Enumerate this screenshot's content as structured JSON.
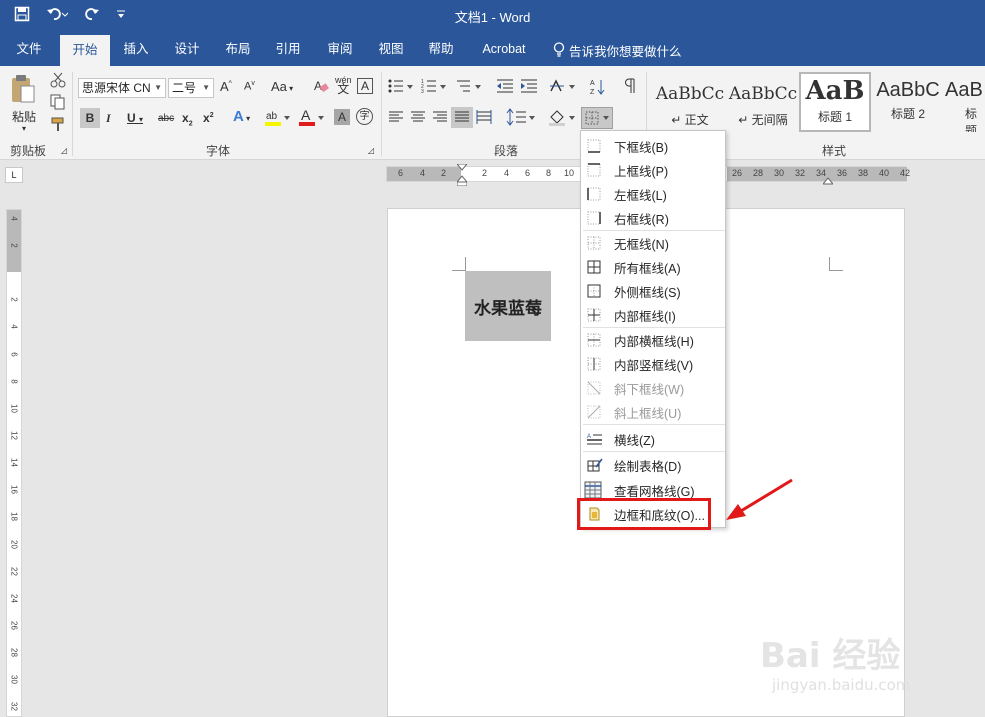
{
  "window": {
    "title": "文档1  -  Word"
  },
  "qat": {
    "save_icon": "save-icon",
    "undo_icon": "undo-icon",
    "redo_icon": "redo-icon",
    "customize_icon": "customize-icon"
  },
  "tabs": [
    {
      "label": "文件"
    },
    {
      "label": "开始"
    },
    {
      "label": "插入"
    },
    {
      "label": "设计"
    },
    {
      "label": "布局"
    },
    {
      "label": "引用"
    },
    {
      "label": "审阅"
    },
    {
      "label": "视图"
    },
    {
      "label": "帮助"
    },
    {
      "label": "Acrobat"
    }
  ],
  "tell_me": "告诉我你想要做什么",
  "ribbon": {
    "clipboard": {
      "paste_label": "粘贴",
      "group": "剪贴板"
    },
    "font": {
      "name": "思源宋体 CN",
      "size": "二号",
      "group": "字体",
      "aa": "Aa",
      "phonetic": "wén"
    },
    "paragraph": {
      "group": "段落"
    },
    "styles": {
      "group": "样式",
      "items": [
        {
          "sample": "AaBbCc",
          "name": "↵ 正文"
        },
        {
          "sample": "AaBbCc",
          "name": "↵ 无间隔"
        },
        {
          "sample": "AaB",
          "name": "标题 1"
        },
        {
          "sample": "AaBbC",
          "name": "标题 2"
        },
        {
          "sample": "AaB",
          "name": "标题"
        }
      ]
    }
  },
  "ruler": {
    "h_left": [
      "6",
      "4",
      "2"
    ],
    "h_mid": [
      "2",
      "4",
      "6",
      "8",
      "10"
    ],
    "h_right": [
      "26",
      "28",
      "30",
      "32",
      "34",
      "36",
      "38",
      "40",
      "42"
    ],
    "v": [
      "4",
      "2",
      "2",
      "4",
      "6",
      "8",
      "10",
      "12",
      "14",
      "16",
      "18",
      "20",
      "22",
      "24",
      "26",
      "28",
      "30",
      "32"
    ]
  },
  "document": {
    "cell_text": "水果蓝莓"
  },
  "border_menu": {
    "items": [
      {
        "label": "下框线(B)",
        "icon": "bottom-border-icon",
        "disabled": false
      },
      {
        "label": "上框线(P)",
        "icon": "top-border-icon",
        "disabled": false
      },
      {
        "label": "左框线(L)",
        "icon": "left-border-icon",
        "disabled": false
      },
      {
        "label": "右框线(R)",
        "icon": "right-border-icon",
        "disabled": false
      },
      {
        "label": "无框线(N)",
        "icon": "no-border-icon",
        "disabled": false
      },
      {
        "label": "所有框线(A)",
        "icon": "all-borders-icon",
        "disabled": false
      },
      {
        "label": "外侧框线(S)",
        "icon": "outside-borders-icon",
        "disabled": false
      },
      {
        "label": "内部框线(I)",
        "icon": "inside-borders-icon",
        "disabled": false
      },
      {
        "label": "内部横框线(H)",
        "icon": "inside-horizontal-border-icon",
        "disabled": false
      },
      {
        "label": "内部竖框线(V)",
        "icon": "inside-vertical-border-icon",
        "disabled": false
      },
      {
        "label": "斜下框线(W)",
        "icon": "diagonal-down-border-icon",
        "disabled": true
      },
      {
        "label": "斜上框线(U)",
        "icon": "diagonal-up-border-icon",
        "disabled": true
      },
      {
        "label": "横线(Z)",
        "icon": "horizontal-line-icon",
        "disabled": false
      },
      {
        "label": "绘制表格(D)",
        "icon": "draw-table-icon",
        "disabled": false
      },
      {
        "label": "查看网格线(G)",
        "icon": "view-gridlines-icon",
        "disabled": false
      },
      {
        "label": "边框和底纹(O)...",
        "icon": "borders-shading-icon",
        "disabled": false
      }
    ]
  },
  "watermark": {
    "brand": "Bai 经验",
    "url": "jingyan.baidu.com"
  },
  "colors": {
    "title_bar": "#2b579a",
    "highlight": "#e11919"
  }
}
